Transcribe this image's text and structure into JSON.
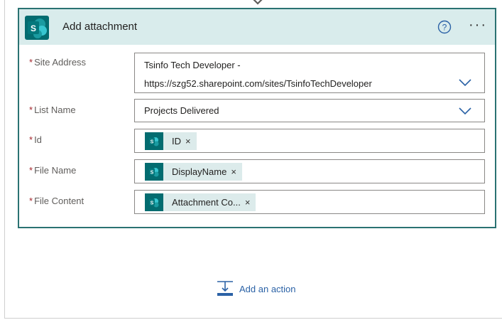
{
  "card": {
    "title": "Add attachment",
    "icons": {
      "logo": "sharepoint-icon",
      "help": "help-circle-icon",
      "more": "more-ellipsis-icon"
    },
    "more_glyph": "···"
  },
  "fields": {
    "site_address": {
      "label": "Site Address",
      "required_mark": "*",
      "value_line1": "Tsinfo Tech Developer -",
      "value_line2": "https://szg52.sharepoint.com/sites/TsinfoTechDeveloper"
    },
    "list_name": {
      "label": "List Name",
      "required_mark": "*",
      "value": "Projects Delivered"
    },
    "id": {
      "label": "Id",
      "required_mark": "*",
      "token": "ID",
      "remove_glyph": "×"
    },
    "file_name": {
      "label": "File Name",
      "required_mark": "*",
      "token": "DisplayName",
      "remove_glyph": "×"
    },
    "file_content": {
      "label": "File Content",
      "required_mark": "*",
      "token": "Attachment Co...",
      "remove_glyph": "×"
    }
  },
  "add_action": {
    "label": "Add an action",
    "icon": "insert-step-icon"
  },
  "colors": {
    "header_bg": "#d9ecec",
    "card_border": "#2a7272",
    "sharepoint_teal": "#036c70",
    "token_bg": "#dcebeb",
    "required": "#a4262c",
    "link_blue": "#2b62a6"
  }
}
